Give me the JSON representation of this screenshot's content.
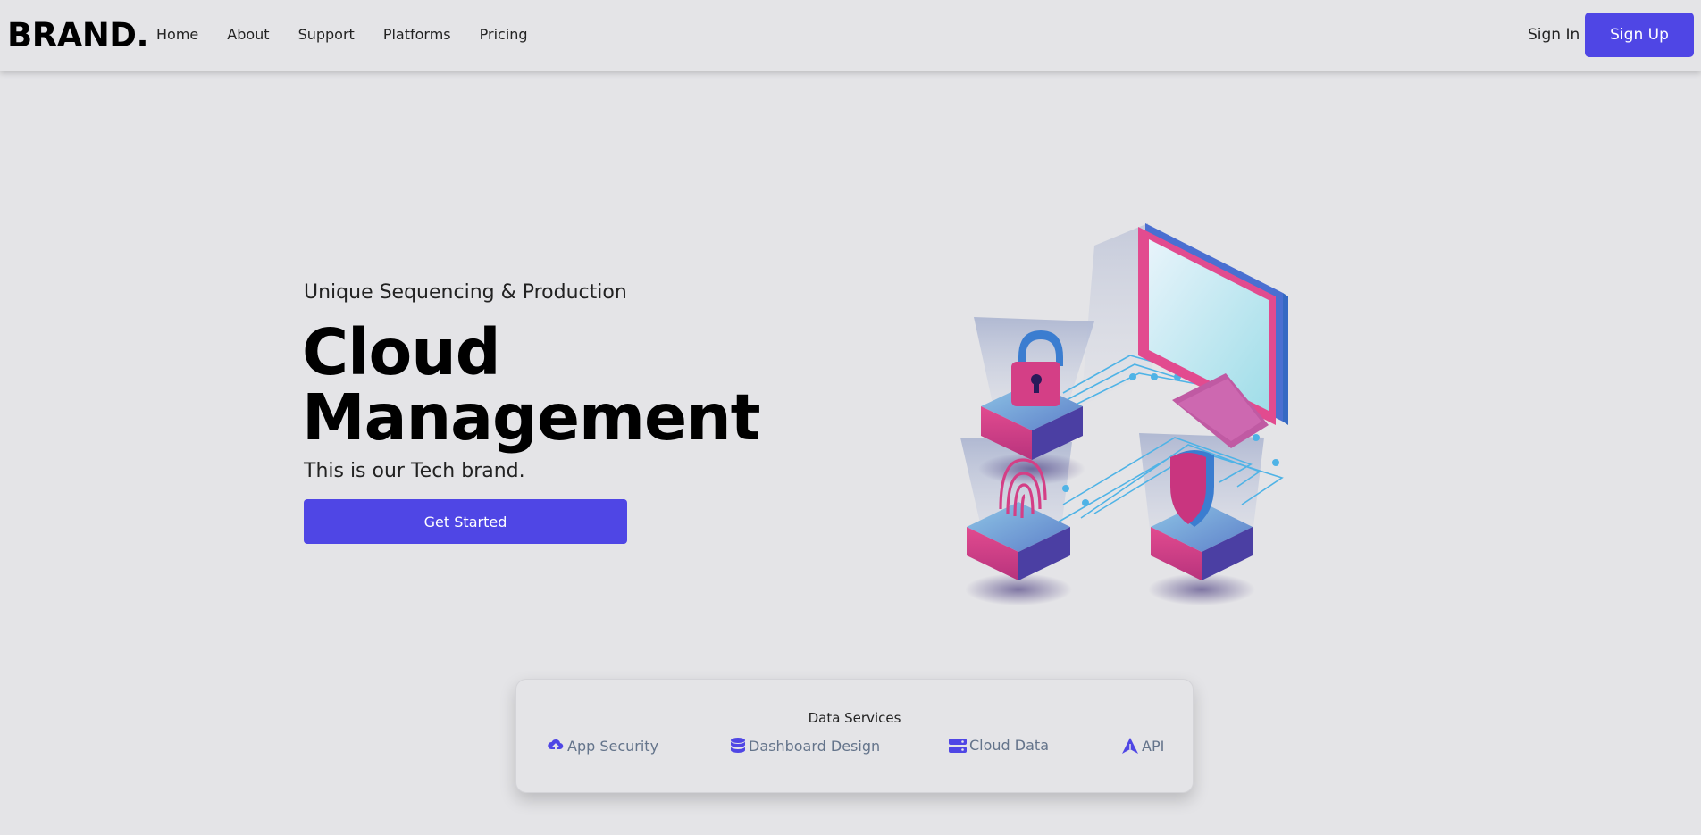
{
  "brand": "BRAND.",
  "nav": {
    "links": [
      "Home",
      "About",
      "Support",
      "Platforms",
      "Pricing"
    ],
    "sign_in": "Sign In",
    "sign_up": "Sign Up"
  },
  "hero": {
    "subtitle": "Unique Sequencing & Production",
    "title_line1": "Cloud",
    "title_line2": "Management",
    "tagline": "This is our Tech brand.",
    "cta": "Get Started"
  },
  "services": {
    "title": "Data Services",
    "items": [
      {
        "label": "App Security",
        "icon": "cloud-upload-icon"
      },
      {
        "label": "Dashboard Design",
        "icon": "database-icon"
      },
      {
        "label": "Cloud Data",
        "icon": "server-icon"
      },
      {
        "label": "API",
        "icon": "api-arrow-icon"
      }
    ]
  },
  "colors": {
    "accent": "#4f46e5",
    "background": "#e4e4e7",
    "muted_text": "#64748b"
  }
}
